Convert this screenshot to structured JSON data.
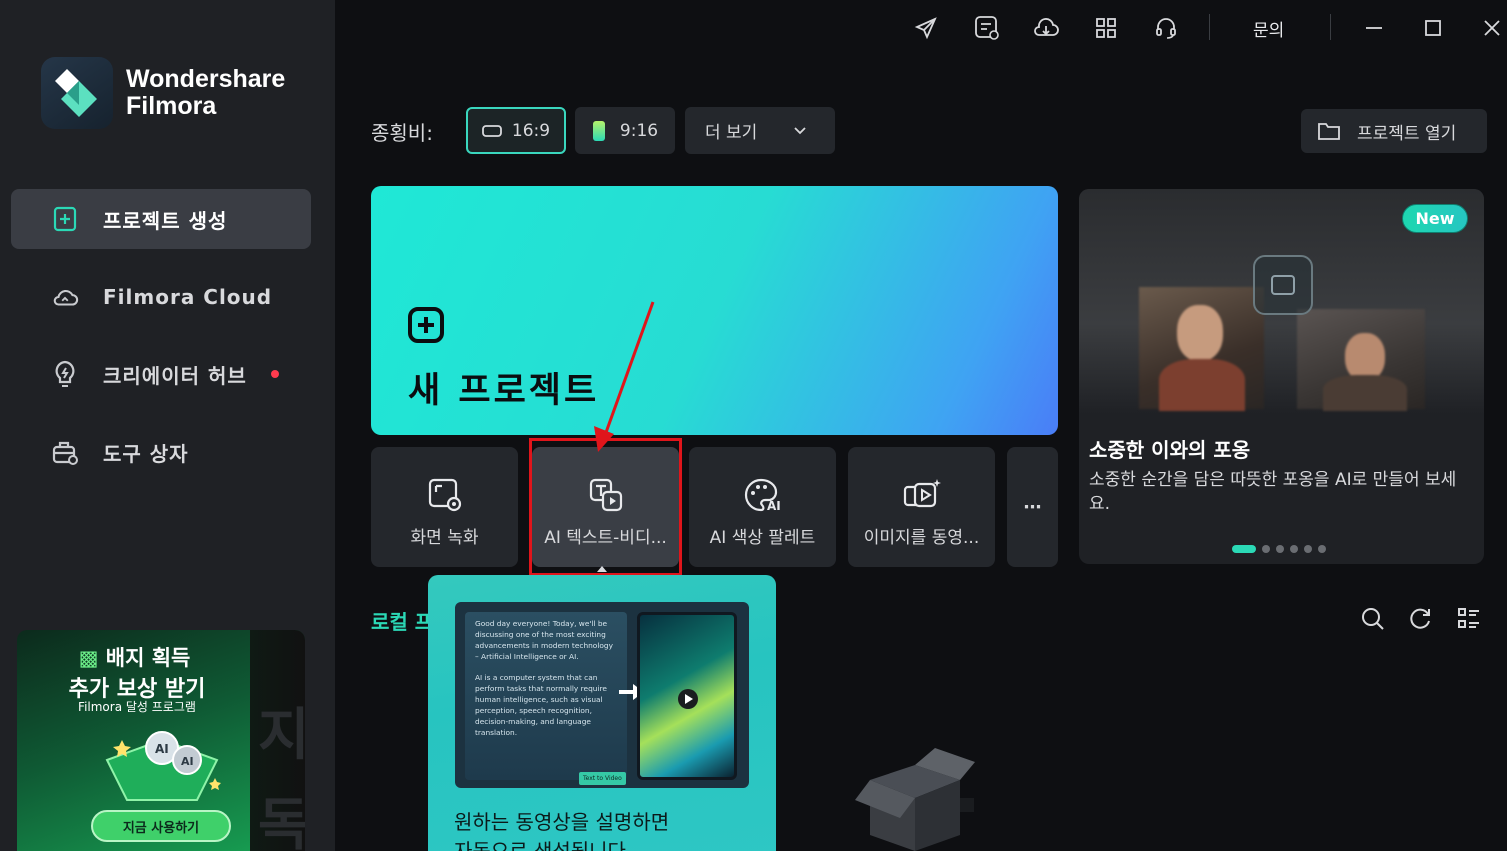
{
  "app": {
    "brand_line1": "Wondershare",
    "brand_line2": "Filmora"
  },
  "sidebar": {
    "items": [
      {
        "label": "프로젝트 생성",
        "icon": "new-project-icon",
        "active": true
      },
      {
        "label": "Filmora Cloud",
        "icon": "cloud-icon"
      },
      {
        "label": "크리에이터 허브",
        "icon": "lightbulb-icon",
        "badge_dot": true
      },
      {
        "label": "도구 상자",
        "icon": "toolbox-icon"
      }
    ],
    "promo": {
      "line1": "배지 획득",
      "line2": "추가 보상 받기",
      "line3": "Filmora 달성 프로그램",
      "button": "지금 사용하기",
      "side_text": [
        "지",
        "독"
      ]
    }
  },
  "titlebar": {
    "icons": [
      "send-icon",
      "feedback-icon",
      "cloud-download-icon",
      "apps-grid-icon",
      "headset-icon"
    ],
    "inquiry": "문의"
  },
  "aspect": {
    "label": "종횡비:",
    "options": [
      "16:9",
      "9:16"
    ],
    "selected": "16:9",
    "more": "더 보기",
    "open_project": "프로젝트 열기"
  },
  "new_project": {
    "title": "새 프로젝트"
  },
  "tools": [
    {
      "label": "화면 녹화",
      "icon": "screen-record-icon"
    },
    {
      "label": "AI 텍스트-비디...",
      "icon": "ai-text-to-video-icon"
    },
    {
      "label": "AI 색상 팔레트",
      "icon": "ai-color-palette-icon"
    },
    {
      "label": "이미지를 동영...",
      "icon": "image-to-video-icon"
    }
  ],
  "carousel": {
    "badge": "New",
    "title": "소중한 이와의 포옹",
    "description": "소중한 순간을 담은 따뜻한 포옹을 AI로 만들어 보세요.",
    "page_count": 6,
    "current_page": 1
  },
  "local": {
    "label": "로컬 프"
  },
  "popup": {
    "doc_para1": "Good day everyone! Today, we'll be discussing one of the most exciting advancements in modern technology – Artificial Intelligence or AI.",
    "doc_para2": "AI is a computer system that can perform tasks that normally require human intelligence, such as visual perception, speech recognition, decision-making, and language translation.",
    "doc_tag": "Text to Video",
    "text_line1": "원하는 동영상을 설명하면",
    "text_line2": "자동으로 생성됩니다"
  },
  "colors": {
    "accent": "#2bd9b6",
    "highlight": "#e0151b",
    "sidebar_bg": "#1f2125",
    "main_bg": "#0e0f12"
  }
}
